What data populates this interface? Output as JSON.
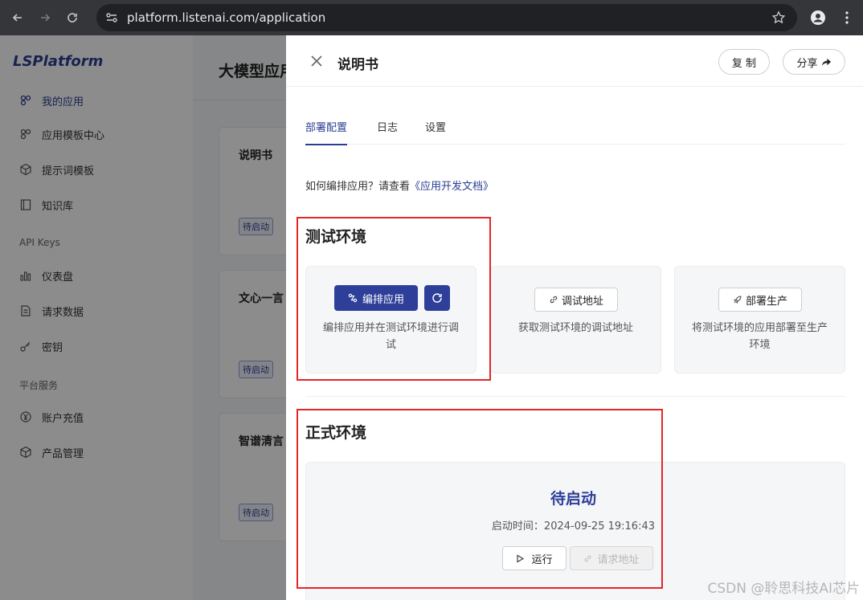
{
  "browser": {
    "url": "platform.listenai.com/application"
  },
  "sidebar": {
    "logo": "LSPlatform",
    "items": [
      {
        "label": "我的应用",
        "icon": "apps-icon"
      },
      {
        "label": "应用模板中心",
        "icon": "template-icon"
      },
      {
        "label": "提示词模板",
        "icon": "cube-icon"
      },
      {
        "label": "知识库",
        "icon": "book-icon"
      }
    ],
    "section_api": "API Keys",
    "api_items": [
      {
        "label": "仪表盘",
        "icon": "chart-icon"
      },
      {
        "label": "请求数据",
        "icon": "document-icon"
      },
      {
        "label": "密钥",
        "icon": "key-icon"
      }
    ],
    "section_platform": "平台服务",
    "platform_items": [
      {
        "label": "账户充值",
        "icon": "yen-icon"
      },
      {
        "label": "产品管理",
        "icon": "box-icon"
      }
    ]
  },
  "main": {
    "title": "大模型应用",
    "cards": [
      {
        "title": "说明书",
        "badge": "待启动"
      },
      {
        "title": "文心一言",
        "badge": "待启动"
      },
      {
        "title": "智谱清言",
        "badge": "待启动"
      }
    ]
  },
  "drawer": {
    "title": "说明书",
    "copy_label": "复 制",
    "share_label": "分享",
    "tabs": [
      "部署配置",
      "日志",
      "设置"
    ],
    "howto_prefix": "如何编排应用？请查看",
    "howto_link": "《应用开发文档》",
    "test_env": {
      "title": "测试环境",
      "edit_label": "编排应用",
      "edit_desc": "编排应用并在测试环境进行调试",
      "debug_label": "调试地址",
      "debug_desc": "获取测试环境的调试地址",
      "deploy_label": "部署生产",
      "deploy_desc": "将测试环境的应用部署至生产环境"
    },
    "prod_env": {
      "title": "正式环境",
      "status": "待启动",
      "start_time": "启动时间：2024-09-25 19:16:43",
      "run_label": "运行",
      "request_label": "请求地址"
    }
  },
  "watermark": "CSDN @聆思科技AI芯片",
  "colors": {
    "accent": "#2d3f99",
    "highlight_box": "#e52626"
  }
}
